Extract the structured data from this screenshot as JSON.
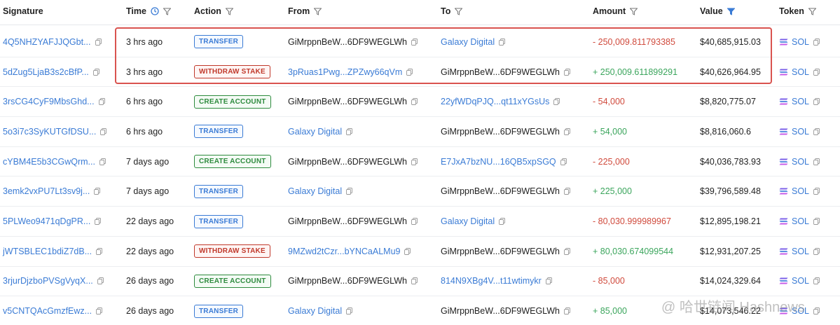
{
  "header": {
    "signature": "Signature",
    "time": "Time",
    "action": "Action",
    "from": "From",
    "to": "To",
    "amount": "Amount",
    "value": "Value",
    "token": "Token"
  },
  "colors": {
    "link": "#3a7bd5",
    "negative": "#d04a3c",
    "positive": "#3ba55c",
    "highlight_border": "#d9534f",
    "active_filter": "#3a7bd5"
  },
  "rows": [
    {
      "signature": "4Q5NHZYAFJJQGbt...",
      "time": "3 hrs ago",
      "action": "TRANSFER",
      "action_type": "transfer",
      "from": "GiMrppnBeW...6DF9WEGLWh",
      "from_link": false,
      "to": "Galaxy Digital",
      "to_link": true,
      "amount": "- 250,009.811793385",
      "amount_sign": "neg",
      "value": "$40,685,915.03",
      "token": "SOL"
    },
    {
      "signature": "5dZug5LjaB3s2cBfP...",
      "time": "3 hrs ago",
      "action": "WITHDRAW STAKE",
      "action_type": "withdraw",
      "from": "3pRuas1Pwg...ZPZwy66qVm",
      "from_link": true,
      "to": "GiMrppnBeW...6DF9WEGLWh",
      "to_link": false,
      "amount": "+ 250,009.611899291",
      "amount_sign": "pos",
      "value": "$40,626,964.95",
      "token": "SOL"
    },
    {
      "signature": "3rsCG4CyF9MbsGhd...",
      "time": "6 hrs ago",
      "action": "CREATE ACCOUNT",
      "action_type": "create",
      "from": "GiMrppnBeW...6DF9WEGLWh",
      "from_link": false,
      "to": "22yfWDqPJQ...qt11xYGsUs",
      "to_link": true,
      "amount": "- 54,000",
      "amount_sign": "neg",
      "value": "$8,820,775.07",
      "token": "SOL"
    },
    {
      "signature": "5o3i7c3SyKUTGfDSU...",
      "time": "6 hrs ago",
      "action": "TRANSFER",
      "action_type": "transfer",
      "from": "Galaxy Digital",
      "from_link": true,
      "to": "GiMrppnBeW...6DF9WEGLWh",
      "to_link": false,
      "amount": "+ 54,000",
      "amount_sign": "pos",
      "value": "$8,816,060.6",
      "token": "SOL"
    },
    {
      "signature": "cYBM4E5b3CGwQrm...",
      "time": "7 days ago",
      "action": "CREATE ACCOUNT",
      "action_type": "create",
      "from": "GiMrppnBeW...6DF9WEGLWh",
      "from_link": false,
      "to": "E7JxA7bzNU...16QB5xpSGQ",
      "to_link": true,
      "amount": "- 225,000",
      "amount_sign": "neg",
      "value": "$40,036,783.93",
      "token": "SOL"
    },
    {
      "signature": "3emk2vxPU7Lt3sv9j...",
      "time": "7 days ago",
      "action": "TRANSFER",
      "action_type": "transfer",
      "from": "Galaxy Digital",
      "from_link": true,
      "to": "GiMrppnBeW...6DF9WEGLWh",
      "to_link": false,
      "amount": "+ 225,000",
      "amount_sign": "pos",
      "value": "$39,796,589.48",
      "token": "SOL"
    },
    {
      "signature": "5PLWeo9471qDgPR...",
      "time": "22 days ago",
      "action": "TRANSFER",
      "action_type": "transfer",
      "from": "GiMrppnBeW...6DF9WEGLWh",
      "from_link": false,
      "to": "Galaxy Digital",
      "to_link": true,
      "amount": "- 80,030.999989967",
      "amount_sign": "neg",
      "value": "$12,895,198.21",
      "token": "SOL"
    },
    {
      "signature": "jWTSBLEC1bdiZ7dB...",
      "time": "22 days ago",
      "action": "WITHDRAW STAKE",
      "action_type": "withdraw",
      "from": "9MZwd2tCzr...bYNCaALMu9",
      "from_link": true,
      "to": "GiMrppnBeW...6DF9WEGLWh",
      "to_link": false,
      "amount": "+ 80,030.674099544",
      "amount_sign": "pos",
      "value": "$12,931,207.25",
      "token": "SOL"
    },
    {
      "signature": "3rjurDjzboPVSgVyqX...",
      "time": "26 days ago",
      "action": "CREATE ACCOUNT",
      "action_type": "create",
      "from": "GiMrppnBeW...6DF9WEGLWh",
      "from_link": false,
      "to": "814N9XBg4V...t11wtimykr",
      "to_link": true,
      "amount": "- 85,000",
      "amount_sign": "neg",
      "value": "$14,024,329.64",
      "token": "SOL"
    },
    {
      "signature": "v5CNTQAcGmzfEwz...",
      "time": "26 days ago",
      "action": "TRANSFER",
      "action_type": "transfer",
      "from": "Galaxy Digital",
      "from_link": true,
      "to": "GiMrppnBeW...6DF9WEGLWh",
      "to_link": false,
      "amount": "+ 85,000",
      "amount_sign": "pos",
      "value": "$14,073,546.22",
      "token": "SOL"
    }
  ],
  "watermark": "@ 哈世链闻 Hashnews"
}
